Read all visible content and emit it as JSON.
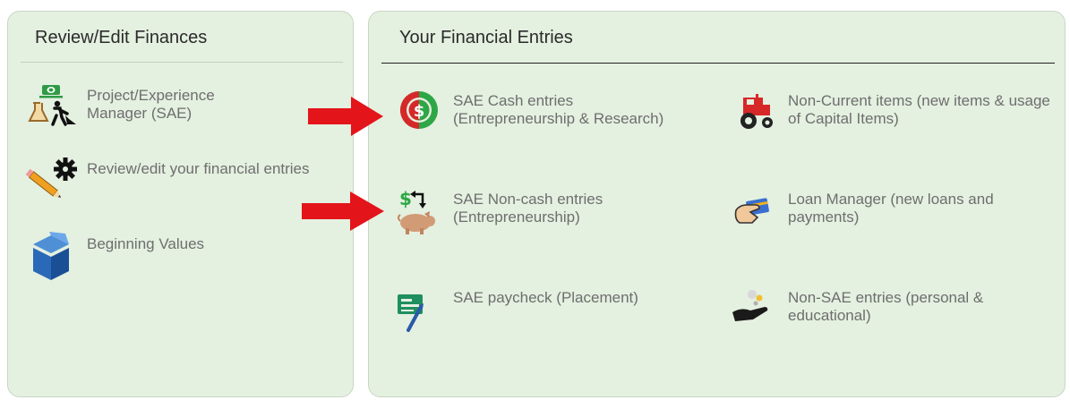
{
  "left_panel": {
    "title": "Review/Edit Finances",
    "items": [
      {
        "label": "Project/Experience Manager (SAE)",
        "icon": "project-manager-icon"
      },
      {
        "label": "Review/edit your financial entries",
        "icon": "pencil-gear-icon"
      },
      {
        "label": "Beginning Values",
        "icon": "cube-icon"
      }
    ]
  },
  "right_panel": {
    "title": "Your Financial Entries",
    "items": [
      {
        "label": "SAE Cash entries (Entrepreneurship & Research)",
        "icon": "dollar-coin-icon"
      },
      {
        "label": "Non-Current items (new items & usage of Capital Items)",
        "icon": "tractor-icon"
      },
      {
        "label": "SAE Non-cash entries (Entrepreneurship)",
        "icon": "dollar-pig-icon"
      },
      {
        "label": "Loan Manager (new loans and payments)",
        "icon": "card-hand-icon"
      },
      {
        "label": "SAE paycheck (Placement)",
        "icon": "paycheck-icon"
      },
      {
        "label": "Non-SAE entries (personal & educational)",
        "icon": "hand-coins-icon"
      }
    ]
  },
  "colors": {
    "panel_bg": "#e4f0e0",
    "arrow": "#e3151a",
    "label_text": "#6e6e6e"
  }
}
